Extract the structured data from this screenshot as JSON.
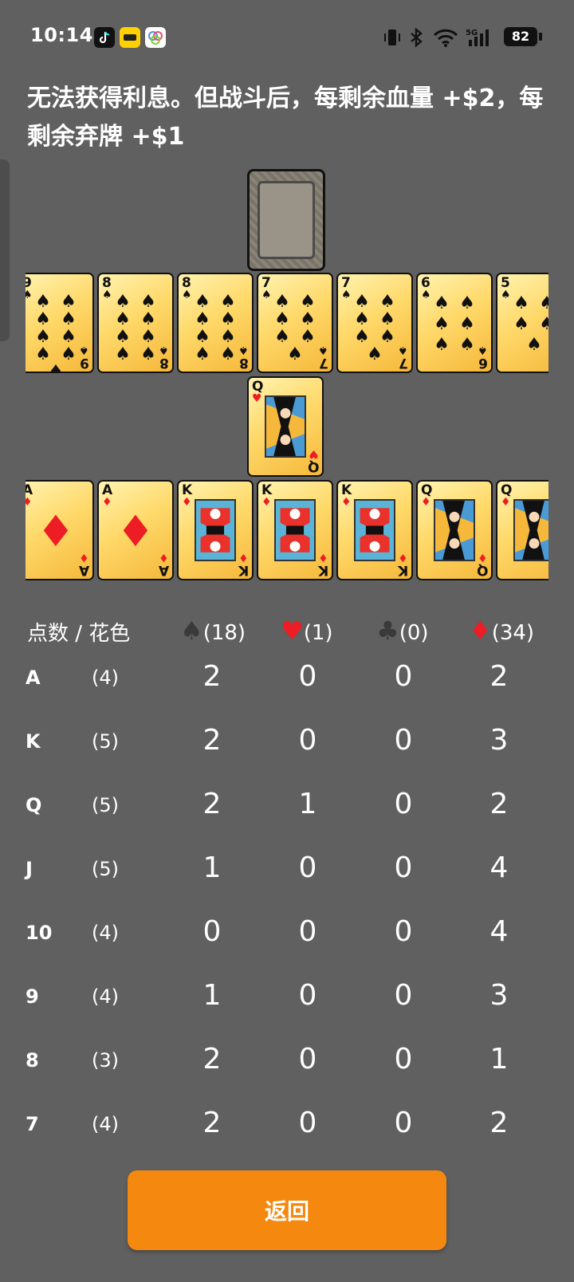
{
  "status_bar": {
    "time": "10:14",
    "battery": "82",
    "network": "5G"
  },
  "headline": "无法获得利息。但战斗后，每剩余血量 +$2，每剩余弃牌 +$1",
  "remaining_row": [
    {
      "rank": "9",
      "suit": "♠",
      "color": "black",
      "pips": 9
    },
    {
      "rank": "8",
      "suit": "♠",
      "color": "black",
      "pips": 8
    },
    {
      "rank": "8",
      "suit": "♠",
      "color": "black",
      "pips": 8
    },
    {
      "rank": "7",
      "suit": "♠",
      "color": "black",
      "pips": 7
    },
    {
      "rank": "7",
      "suit": "♠",
      "color": "black",
      "pips": 7
    },
    {
      "rank": "6",
      "suit": "♠",
      "color": "black",
      "pips": 6
    },
    {
      "rank": "5",
      "suit": "♠",
      "color": "black",
      "pips": 5
    }
  ],
  "middle_card": {
    "rank": "Q",
    "suit": "♥",
    "color": "red"
  },
  "bottom_row": [
    {
      "rank": "A",
      "suit": "♦",
      "color": "red"
    },
    {
      "rank": "A",
      "suit": "♦",
      "color": "red"
    },
    {
      "rank": "K",
      "suit": "♦",
      "color": "red"
    },
    {
      "rank": "K",
      "suit": "♦",
      "color": "red"
    },
    {
      "rank": "K",
      "suit": "♦",
      "color": "red"
    },
    {
      "rank": "Q",
      "suit": "♦",
      "color": "red"
    },
    {
      "rank": "Q",
      "suit": "♦",
      "color": "red"
    }
  ],
  "table": {
    "header_label": "点数 / 花色",
    "suits": [
      {
        "symbol": "♠",
        "count": "(18)",
        "color": "#3a3a3a"
      },
      {
        "symbol": "♥",
        "count": "(1)",
        "color": "#ee1c24"
      },
      {
        "symbol": "♣",
        "count": "(0)",
        "color": "#3a3a3a"
      },
      {
        "symbol": "♦",
        "count": "(34)",
        "color": "#ee1c24"
      }
    ],
    "rows": [
      {
        "rank": "A",
        "total": "(4)",
        "values": [
          "2",
          "0",
          "0",
          "2"
        ]
      },
      {
        "rank": "K",
        "total": "(5)",
        "values": [
          "2",
          "0",
          "0",
          "3"
        ]
      },
      {
        "rank": "Q",
        "total": "(5)",
        "values": [
          "2",
          "1",
          "0",
          "2"
        ]
      },
      {
        "rank": "J",
        "total": "(5)",
        "values": [
          "1",
          "0",
          "0",
          "4"
        ]
      },
      {
        "rank": "10",
        "total": "(4)",
        "values": [
          "0",
          "0",
          "0",
          "4"
        ]
      },
      {
        "rank": "9",
        "total": "(4)",
        "values": [
          "1",
          "0",
          "0",
          "3"
        ]
      },
      {
        "rank": "8",
        "total": "(3)",
        "values": [
          "2",
          "0",
          "0",
          "1"
        ]
      },
      {
        "rank": "7",
        "total": "(4)",
        "values": [
          "2",
          "0",
          "0",
          "2"
        ]
      }
    ]
  },
  "back_button": "返回",
  "colors": {
    "accent": "#f5890f",
    "background": "#606060",
    "red_suit": "#ee1c24"
  }
}
